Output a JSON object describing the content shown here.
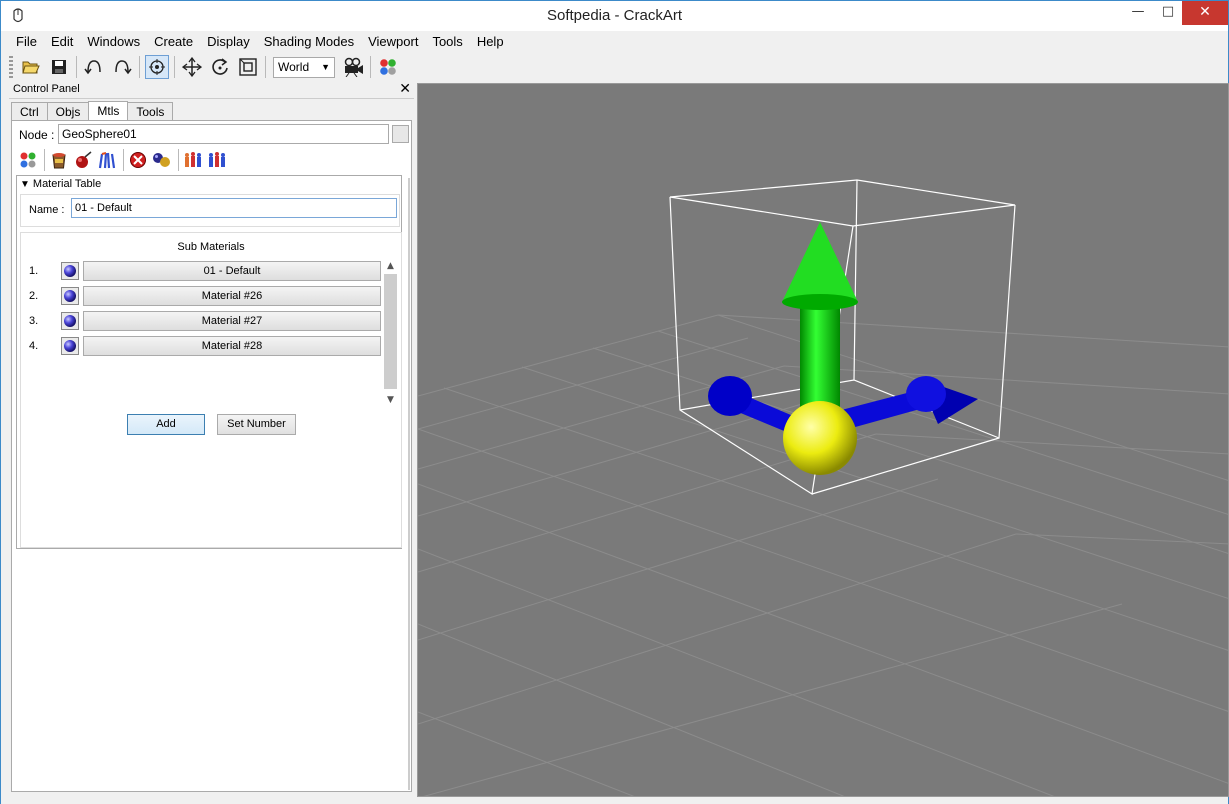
{
  "window": {
    "title": "Softpedia - CrackArt",
    "minimize": "—",
    "maximize": "□",
    "close": "✕"
  },
  "menu": [
    "File",
    "Edit",
    "Windows",
    "Create",
    "Display",
    "Shading Modes",
    "Viewport",
    "Tools",
    "Help"
  ],
  "toolbar": {
    "coordinate_system": "World",
    "icons": [
      "open-icon",
      "save-icon",
      "undo-icon",
      "redo-icon",
      "select-icon",
      "move-icon",
      "rotate-icon",
      "scale-icon",
      "camera-icon",
      "materials-icon"
    ]
  },
  "control_panel": {
    "title": "Control Panel",
    "close": "✕",
    "tabs": [
      "Ctrl",
      "Objs",
      "Mtls",
      "Tools"
    ],
    "active_tab": "Mtls",
    "node_label": "Node :",
    "node_value": "GeoSphere01",
    "material_table_label": "Material Table",
    "name_label": "Name :",
    "name_value": "01 - Default",
    "sub_materials_title": "Sub Materials",
    "sub_materials": [
      {
        "num": "1.",
        "label": "01 - Default"
      },
      {
        "num": "2.",
        "label": "Material #26"
      },
      {
        "num": "3.",
        "label": "Material #27"
      },
      {
        "num": "4.",
        "label": "Material #28"
      }
    ],
    "add_label": "Add",
    "set_number_label": "Set Number"
  },
  "colors": {
    "viewport_bg": "#7a7a7a",
    "grid_line": "#8c8c8c",
    "y_axis": "#00e600",
    "x_z_axis": "#0000ee",
    "pivot": "#f0f000",
    "bbox": "#ffffff",
    "title_close": "#c7372f"
  }
}
